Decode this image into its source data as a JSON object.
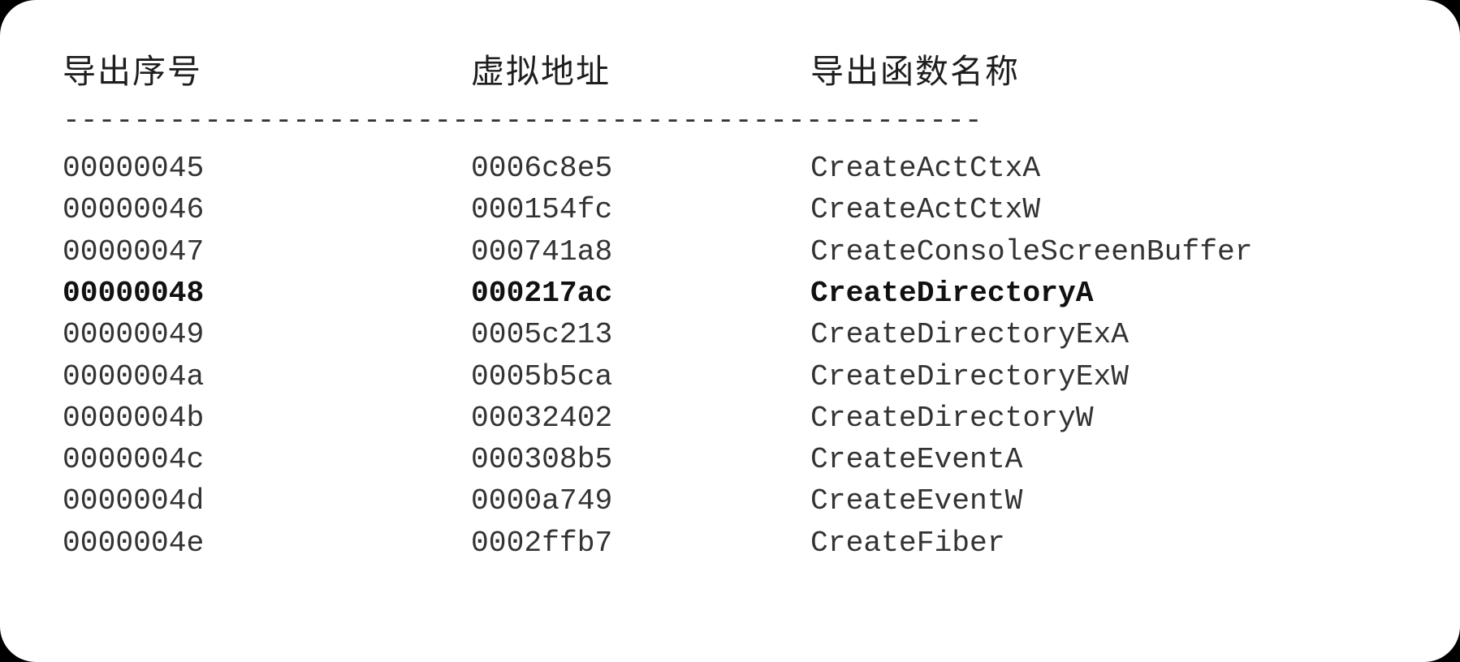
{
  "table": {
    "headers": [
      "导出序号",
      "虚拟地址",
      "导出函数名称"
    ],
    "divider": "----------------------------------------------------",
    "rows": [
      {
        "ordinal": "00000045",
        "address": "0006c8e5",
        "name": "CreateActCtxA",
        "highlighted": false
      },
      {
        "ordinal": "00000046",
        "address": "000154fc",
        "name": "CreateActCtxW",
        "highlighted": false
      },
      {
        "ordinal": "00000047",
        "address": "000741a8",
        "name": "CreateConsoleScreenBuffer",
        "highlighted": false
      },
      {
        "ordinal": "00000048",
        "address": "000217ac",
        "name": "CreateDirectoryA",
        "highlighted": true
      },
      {
        "ordinal": "00000049",
        "address": "0005c213",
        "name": "CreateDirectoryExA",
        "highlighted": false
      },
      {
        "ordinal": "0000004a",
        "address": "0005b5ca",
        "name": "CreateDirectoryExW",
        "highlighted": false
      },
      {
        "ordinal": "0000004b",
        "address": "00032402",
        "name": "CreateDirectoryW",
        "highlighted": false
      },
      {
        "ordinal": "0000004c",
        "address": "000308b5",
        "name": "CreateEventA",
        "highlighted": false
      },
      {
        "ordinal": "0000004d",
        "address": "0000a749",
        "name": "CreateEventW",
        "highlighted": false
      },
      {
        "ordinal": "0000004e",
        "address": "0002ffb7",
        "name": "CreateFiber",
        "highlighted": false
      }
    ]
  }
}
